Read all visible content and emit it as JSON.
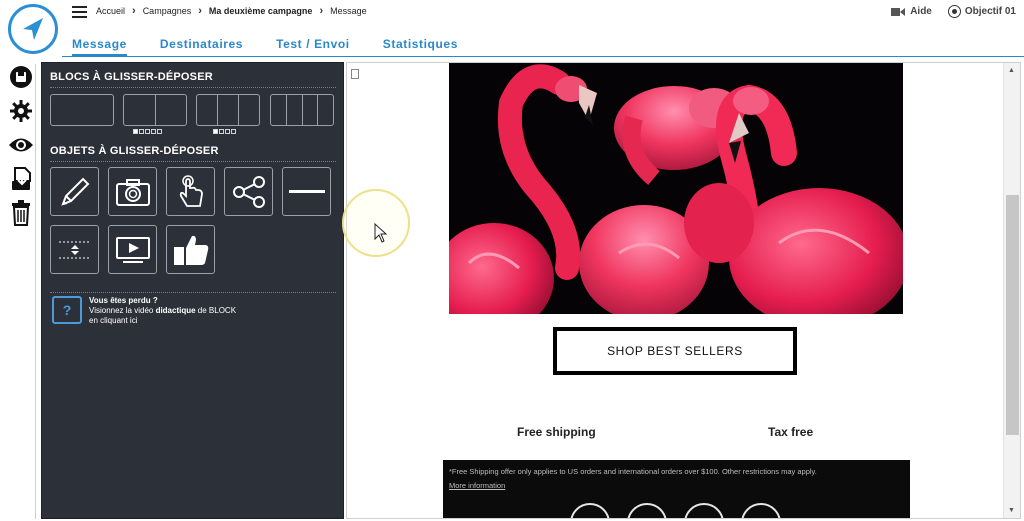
{
  "header": {
    "breadcrumb": [
      "Accueil",
      "Campagnes",
      "Ma deuxième campagne",
      "Message"
    ],
    "help_label": "Aide",
    "user_label": "Objectif 01"
  },
  "tabs": [
    {
      "label": "Message",
      "active": true
    },
    {
      "label": "Destinataires",
      "active": false
    },
    {
      "label": "Test / Envoi",
      "active": false
    },
    {
      "label": "Statistiques",
      "active": false
    }
  ],
  "rail_icons": [
    "save-icon",
    "settings-gear-icon",
    "preview-eye-icon",
    "export-document-icon",
    "trash-icon"
  ],
  "panel": {
    "blocks_title": "BLOCS À GLISSER-DÉPOSER",
    "objects_title": "OBJETS À GLISSER-DÉPOSER",
    "objects": [
      "text-pencil-icon",
      "image-camera-icon",
      "button-hand-icon",
      "share-icon",
      "divider-line-icon",
      "spacer-icon",
      "video-icon",
      "like-thumb-icon"
    ],
    "help": {
      "title": "Vous êtes perdu ?",
      "line1_a": "Visionnez la vidéo ",
      "line1_b": "didactique",
      "line1_c": " de BLOCK",
      "line2": "en cliquant ici"
    }
  },
  "email": {
    "cta_label": "SHOP BEST SELLERS",
    "feature_left": "Free shipping",
    "feature_right": "Tax free",
    "footer_text": "*Free Shipping offer only applies to US orders and international orders over $100. Other restrictions may apply.",
    "footer_link": "More information"
  },
  "colors": {
    "accent": "#2b88c8",
    "panel": "#2c3038",
    "cursor_highlight": "#eee08a"
  }
}
